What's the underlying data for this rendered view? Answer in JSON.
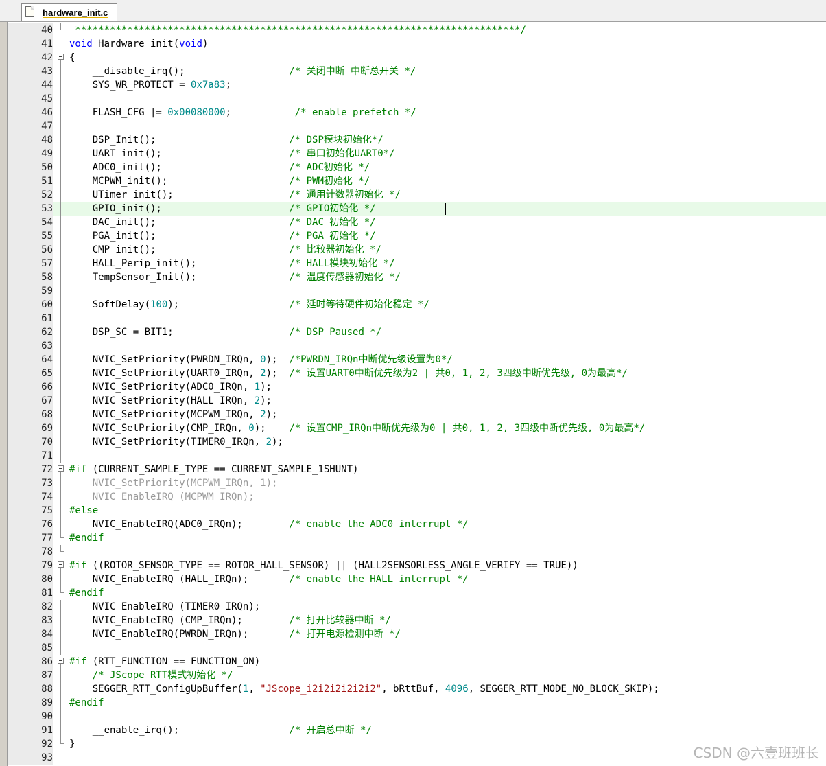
{
  "tab": {
    "title": "hardware_init.c"
  },
  "watermark": "CSDN @六壹班班长",
  "lines": [
    {
      "n": "40",
      "tokens": [
        {
          "t": " *****************************************************************************/",
          "c": "cm"
        }
      ]
    },
    {
      "n": "41",
      "tokens": [
        {
          "t": "void",
          "c": "kw"
        },
        {
          "t": " Hardware_init("
        },
        {
          "t": "void",
          "c": "kw"
        },
        {
          "t": ")"
        }
      ]
    },
    {
      "n": "42",
      "tokens": [
        {
          "t": "{"
        }
      ]
    },
    {
      "n": "43",
      "tokens": [
        {
          "t": "    __disable_irq();                  "
        },
        {
          "t": "/* 关闭中断 中断总开关 */",
          "c": "cm"
        }
      ]
    },
    {
      "n": "44",
      "tokens": [
        {
          "t": "    SYS_WR_PROTECT = "
        },
        {
          "t": "0x7a83",
          "c": "num"
        },
        {
          "t": ";"
        }
      ]
    },
    {
      "n": "45",
      "tokens": []
    },
    {
      "n": "46",
      "tokens": [
        {
          "t": "    FLASH_CFG |= "
        },
        {
          "t": "0x00080000",
          "c": "num"
        },
        {
          "t": ";           "
        },
        {
          "t": "/* enable prefetch */",
          "c": "cm"
        }
      ]
    },
    {
      "n": "47",
      "tokens": []
    },
    {
      "n": "48",
      "tokens": [
        {
          "t": "    DSP_Init();                       "
        },
        {
          "t": "/* DSP模块初始化*/",
          "c": "cm"
        }
      ]
    },
    {
      "n": "49",
      "tokens": [
        {
          "t": "    UART_init();                      "
        },
        {
          "t": "/* 串口初始化UART0*/",
          "c": "cm"
        }
      ]
    },
    {
      "n": "50",
      "tokens": [
        {
          "t": "    ADC0_init();                      "
        },
        {
          "t": "/* ADC初始化 */",
          "c": "cm"
        }
      ]
    },
    {
      "n": "51",
      "tokens": [
        {
          "t": "    MCPWM_init();                     "
        },
        {
          "t": "/* PWM初始化 */",
          "c": "cm"
        }
      ]
    },
    {
      "n": "52",
      "tokens": [
        {
          "t": "    UTimer_init();                    "
        },
        {
          "t": "/* 通用计数器初始化 */",
          "c": "cm"
        }
      ]
    },
    {
      "n": "53",
      "current": true,
      "tokens": [
        {
          "t": "    GPIO_init();                      "
        },
        {
          "t": "/* GPIO初始化 */",
          "c": "cm"
        }
      ]
    },
    {
      "n": "54",
      "tokens": [
        {
          "t": "    DAC_init();                       "
        },
        {
          "t": "/* DAC 初始化 */",
          "c": "cm"
        }
      ]
    },
    {
      "n": "55",
      "tokens": [
        {
          "t": "    PGA_init();                       "
        },
        {
          "t": "/* PGA 初始化 */",
          "c": "cm"
        }
      ]
    },
    {
      "n": "56",
      "tokens": [
        {
          "t": "    CMP_init();                       "
        },
        {
          "t": "/* 比较器初始化 */",
          "c": "cm"
        }
      ]
    },
    {
      "n": "57",
      "tokens": [
        {
          "t": "    HALL_Perip_init();                "
        },
        {
          "t": "/* HALL模块初始化 */",
          "c": "cm"
        }
      ]
    },
    {
      "n": "58",
      "tokens": [
        {
          "t": "    TempSensor_Init();                "
        },
        {
          "t": "/* 温度传感器初始化 */",
          "c": "cm"
        }
      ]
    },
    {
      "n": "59",
      "tokens": []
    },
    {
      "n": "60",
      "tokens": [
        {
          "t": "    SoftDelay("
        },
        {
          "t": "100",
          "c": "num"
        },
        {
          "t": ");                   "
        },
        {
          "t": "/* 延时等待硬件初始化稳定 */",
          "c": "cm"
        }
      ]
    },
    {
      "n": "61",
      "tokens": []
    },
    {
      "n": "62",
      "tokens": [
        {
          "t": "    DSP_SC = BIT1;                    "
        },
        {
          "t": "/* DSP Paused */",
          "c": "cm"
        }
      ]
    },
    {
      "n": "63",
      "tokens": []
    },
    {
      "n": "64",
      "tokens": [
        {
          "t": "    NVIC_SetPriority(PWRDN_IRQn, "
        },
        {
          "t": "0",
          "c": "num"
        },
        {
          "t": ");  "
        },
        {
          "t": "/*PWRDN_IRQn中断优先级设置为0*/",
          "c": "cm"
        }
      ]
    },
    {
      "n": "65",
      "tokens": [
        {
          "t": "    NVIC_SetPriority(UART0_IRQn, "
        },
        {
          "t": "2",
          "c": "num"
        },
        {
          "t": ");  "
        },
        {
          "t": "/* 设置UART0中断优先级为2 | 共0, 1, 2, 3四级中断优先级, 0为最高*/",
          "c": "cm"
        }
      ]
    },
    {
      "n": "66",
      "tokens": [
        {
          "t": "    NVIC_SetPriority(ADC0_IRQn, "
        },
        {
          "t": "1",
          "c": "num"
        },
        {
          "t": ");"
        }
      ]
    },
    {
      "n": "67",
      "tokens": [
        {
          "t": "    NVIC_SetPriority(HALL_IRQn, "
        },
        {
          "t": "2",
          "c": "num"
        },
        {
          "t": ");"
        }
      ]
    },
    {
      "n": "68",
      "tokens": [
        {
          "t": "    NVIC_SetPriority(MCPWM_IRQn, "
        },
        {
          "t": "2",
          "c": "num"
        },
        {
          "t": ");"
        }
      ]
    },
    {
      "n": "69",
      "tokens": [
        {
          "t": "    NVIC_SetPriority(CMP_IRQn, "
        },
        {
          "t": "0",
          "c": "num"
        },
        {
          "t": ");    "
        },
        {
          "t": "/* 设置CMP_IRQn中断优先级为0 | 共0, 1, 2, 3四级中断优先级, 0为最高*/",
          "c": "cm"
        }
      ]
    },
    {
      "n": "70",
      "tokens": [
        {
          "t": "    NVIC_SetPriority(TIMER0_IRQn, "
        },
        {
          "t": "2",
          "c": "num"
        },
        {
          "t": ");"
        }
      ]
    },
    {
      "n": "71",
      "tokens": []
    },
    {
      "n": "72",
      "tokens": [
        {
          "t": "#if",
          "c": "pp"
        },
        {
          "t": " (CURRENT_SAMPLE_TYPE == CURRENT_SAMPLE_1SHUNT)"
        }
      ]
    },
    {
      "n": "73",
      "tokens": [
        {
          "t": "    NVIC_SetPriority(MCPWM_IRQn, 1);",
          "c": "dis"
        }
      ]
    },
    {
      "n": "74",
      "tokens": [
        {
          "t": "    NVIC_EnableIRQ (MCPWM_IRQn);",
          "c": "dis"
        }
      ]
    },
    {
      "n": "75",
      "tokens": [
        {
          "t": "#else",
          "c": "pp"
        }
      ]
    },
    {
      "n": "76",
      "tokens": [
        {
          "t": "    NVIC_EnableIRQ(ADC0_IRQn);        "
        },
        {
          "t": "/* enable the ADC0 interrupt */",
          "c": "cm"
        }
      ]
    },
    {
      "n": "77",
      "tokens": [
        {
          "t": "#endif",
          "c": "pp"
        }
      ]
    },
    {
      "n": "78",
      "tokens": []
    },
    {
      "n": "79",
      "tokens": [
        {
          "t": "#if",
          "c": "pp"
        },
        {
          "t": " ((ROTOR_SENSOR_TYPE == ROTOR_HALL_SENSOR) || (HALL2SENSORLESS_ANGLE_VERIFY == TRUE))"
        }
      ]
    },
    {
      "n": "80",
      "tokens": [
        {
          "t": "    NVIC_EnableIRQ (HALL_IRQn);       "
        },
        {
          "t": "/* enable the HALL interrupt */",
          "c": "cm"
        }
      ]
    },
    {
      "n": "81",
      "tokens": [
        {
          "t": "#endif",
          "c": "pp"
        }
      ]
    },
    {
      "n": "82",
      "tokens": [
        {
          "t": "    NVIC_EnableIRQ (TIMER0_IRQn);"
        }
      ]
    },
    {
      "n": "83",
      "tokens": [
        {
          "t": "    NVIC_EnableIRQ (CMP_IRQn);        "
        },
        {
          "t": "/* 打开比较器中断 */",
          "c": "cm"
        }
      ]
    },
    {
      "n": "84",
      "tokens": [
        {
          "t": "    NVIC_EnableIRQ(PWRDN_IRQn);       "
        },
        {
          "t": "/* 打开电源检测中断 */",
          "c": "cm"
        }
      ]
    },
    {
      "n": "85",
      "tokens": []
    },
    {
      "n": "86",
      "tokens": [
        {
          "t": "#if",
          "c": "pp"
        },
        {
          "t": " (RTT_FUNCTION == FUNCTION_ON)"
        }
      ]
    },
    {
      "n": "87",
      "tokens": [
        {
          "t": "    "
        },
        {
          "t": "/* JScope RTT模式初始化 */",
          "c": "cm"
        }
      ]
    },
    {
      "n": "88",
      "tokens": [
        {
          "t": "    SEGGER_RTT_ConfigUpBuffer("
        },
        {
          "t": "1",
          "c": "num"
        },
        {
          "t": ", "
        },
        {
          "t": "\"JScope_i2i2i2i2i2i2\"",
          "c": "str"
        },
        {
          "t": ", bRttBuf, "
        },
        {
          "t": "4096",
          "c": "num"
        },
        {
          "t": ", SEGGER_RTT_MODE_NO_BLOCK_SKIP);"
        }
      ]
    },
    {
      "n": "89",
      "tokens": [
        {
          "t": "#endif",
          "c": "pp"
        }
      ]
    },
    {
      "n": "90",
      "tokens": []
    },
    {
      "n": "91",
      "tokens": [
        {
          "t": "    __enable_irq();                   "
        },
        {
          "t": "/* 开启总中断 */",
          "c": "cm"
        }
      ]
    },
    {
      "n": "92",
      "tokens": [
        {
          "t": "}"
        }
      ]
    },
    {
      "n": "93",
      "tokens": []
    }
  ]
}
